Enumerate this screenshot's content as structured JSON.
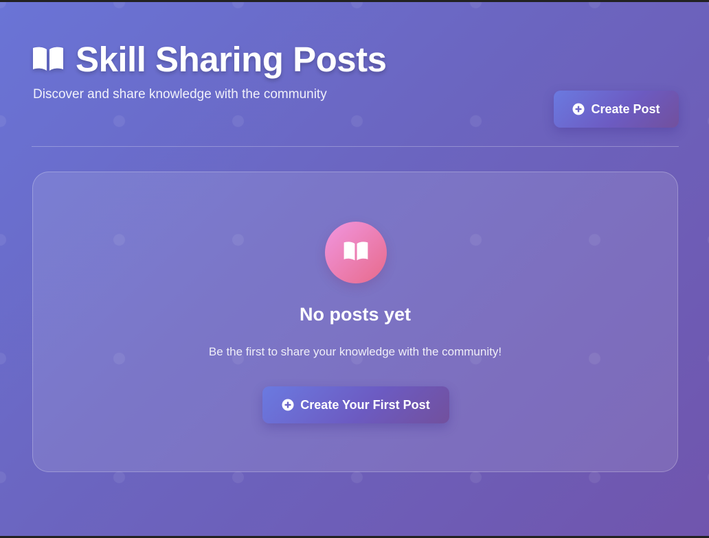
{
  "header": {
    "title": "Skill Sharing Posts",
    "title_icon": "book-open-icon",
    "subtitle": "Discover and share knowledge with the community",
    "create_button_label": "Create Post",
    "create_button_icon": "plus-circle-icon"
  },
  "empty_state": {
    "icon": "book-open-icon",
    "title": "No posts yet",
    "message": "Be the first to share your knowledge with the community!",
    "button_label": "Create Your First Post",
    "button_icon": "plus-circle-icon"
  },
  "colors": {
    "background_start": "#6a74d6",
    "background_end": "#7055ad",
    "icon_gradient_start": "#f196e0",
    "icon_gradient_end": "#e76a8a",
    "text": "#ffffff"
  }
}
